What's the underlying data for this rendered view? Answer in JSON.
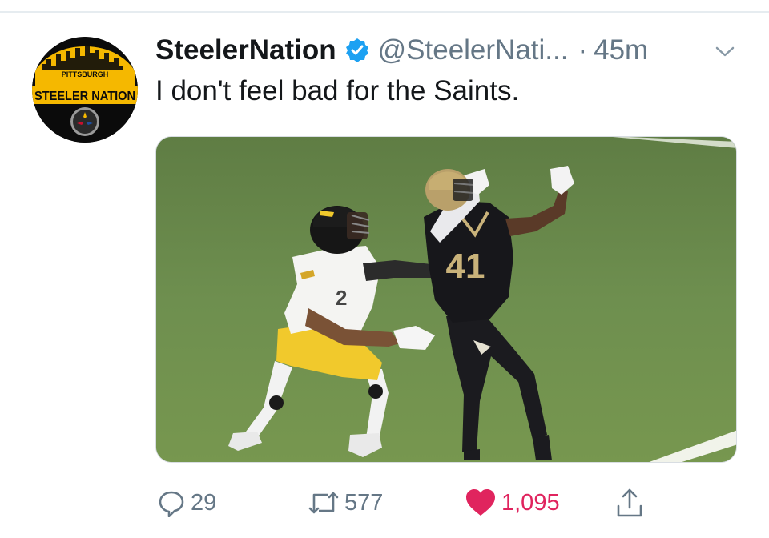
{
  "tweet": {
    "display_name": "SteelerNation",
    "handle": "@SteelerNati...",
    "separator": "·",
    "time": "45m",
    "text": "I don't feel bad for the Saints."
  },
  "avatar": {
    "top_text": "PITTSBURGH",
    "main_text": "STEELER NATION"
  },
  "media": {
    "jersey_number": "41"
  },
  "actions": {
    "reply_count": "29",
    "retweet_count": "577",
    "like_count": "1,095"
  },
  "colors": {
    "verified": "#1da1f2",
    "like": "#e0245e",
    "muted": "#657786",
    "text": "#14171a",
    "steelers_gold": "#f5b800"
  },
  "icons": [
    "verified-badge-icon",
    "chevron-down-icon",
    "reply-icon",
    "retweet-icon",
    "heart-icon",
    "share-icon"
  ]
}
